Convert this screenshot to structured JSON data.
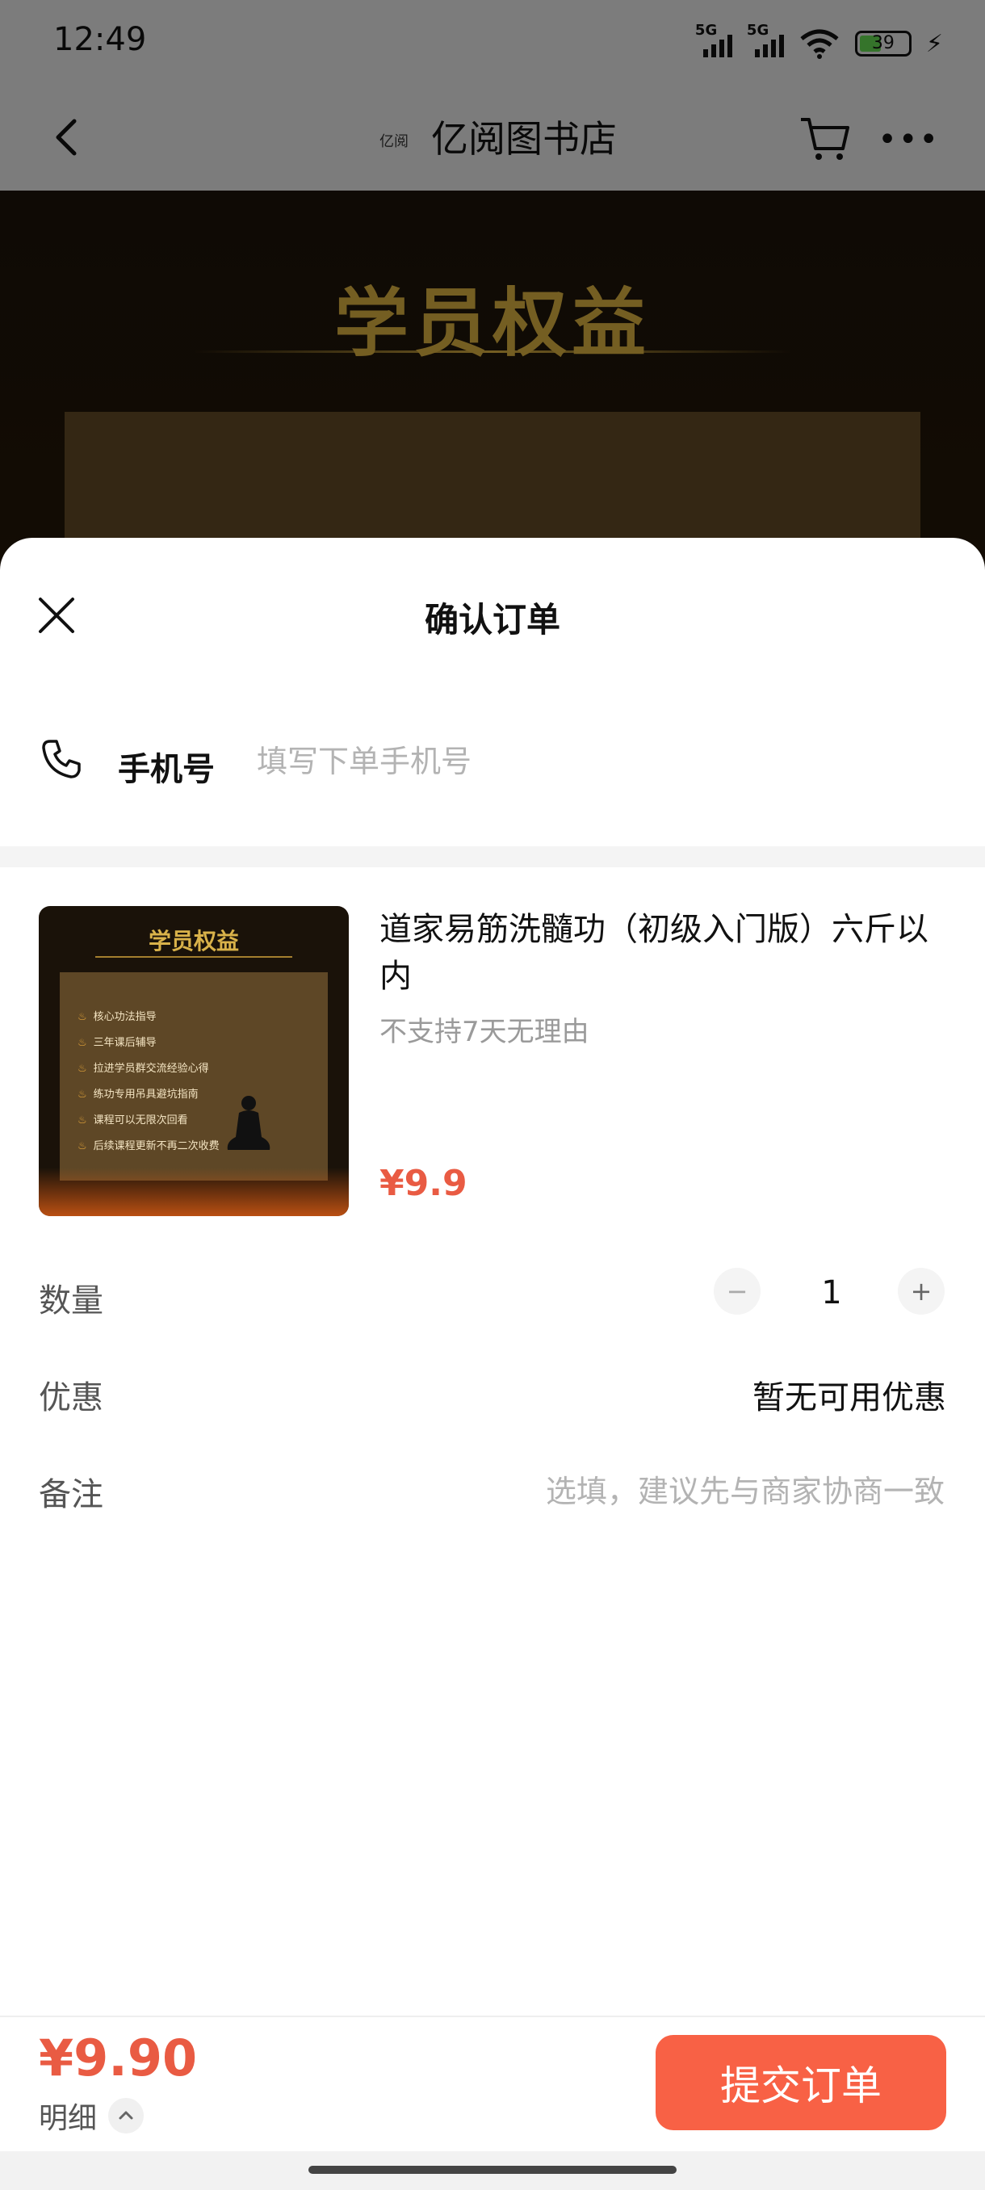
{
  "status_bar": {
    "time": "12:49",
    "network_1": "5G",
    "network_2": "5G",
    "battery": "39"
  },
  "app_bar": {
    "logo_text": "亿阅",
    "title": "亿阅图书店"
  },
  "banner": {
    "title": "学员权益"
  },
  "sheet": {
    "title": "确认订单",
    "phone": {
      "label": "手机号",
      "placeholder": "填写下单手机号",
      "value": ""
    },
    "product": {
      "thumbnail_title": "学员权益",
      "thumbnail_items": [
        "核心功法指导",
        "三年课后辅导",
        "拉进学员群交流经验心得",
        "练功专用吊具避坑指南",
        "课程可以无限次回看",
        "后续课程更新不再二次收费"
      ],
      "name": "道家易筋洗髓功（初级入门版）六斤以内",
      "note": "不支持7天无理由",
      "price": "¥9.9"
    },
    "quantity": {
      "label": "数量",
      "value": "1",
      "minus": "−",
      "plus": "+"
    },
    "discount": {
      "label": "优惠",
      "value": "暂无可用优惠"
    },
    "memo": {
      "label": "备注",
      "placeholder": "选填，建议先与商家协商一致",
      "value": ""
    }
  },
  "footer": {
    "total": "¥9.90",
    "detail_label": "明细",
    "submit_label": "提交订单"
  },
  "colors": {
    "accent": "#f86145",
    "price": "#e95b43",
    "gold": "#c9a23c"
  }
}
